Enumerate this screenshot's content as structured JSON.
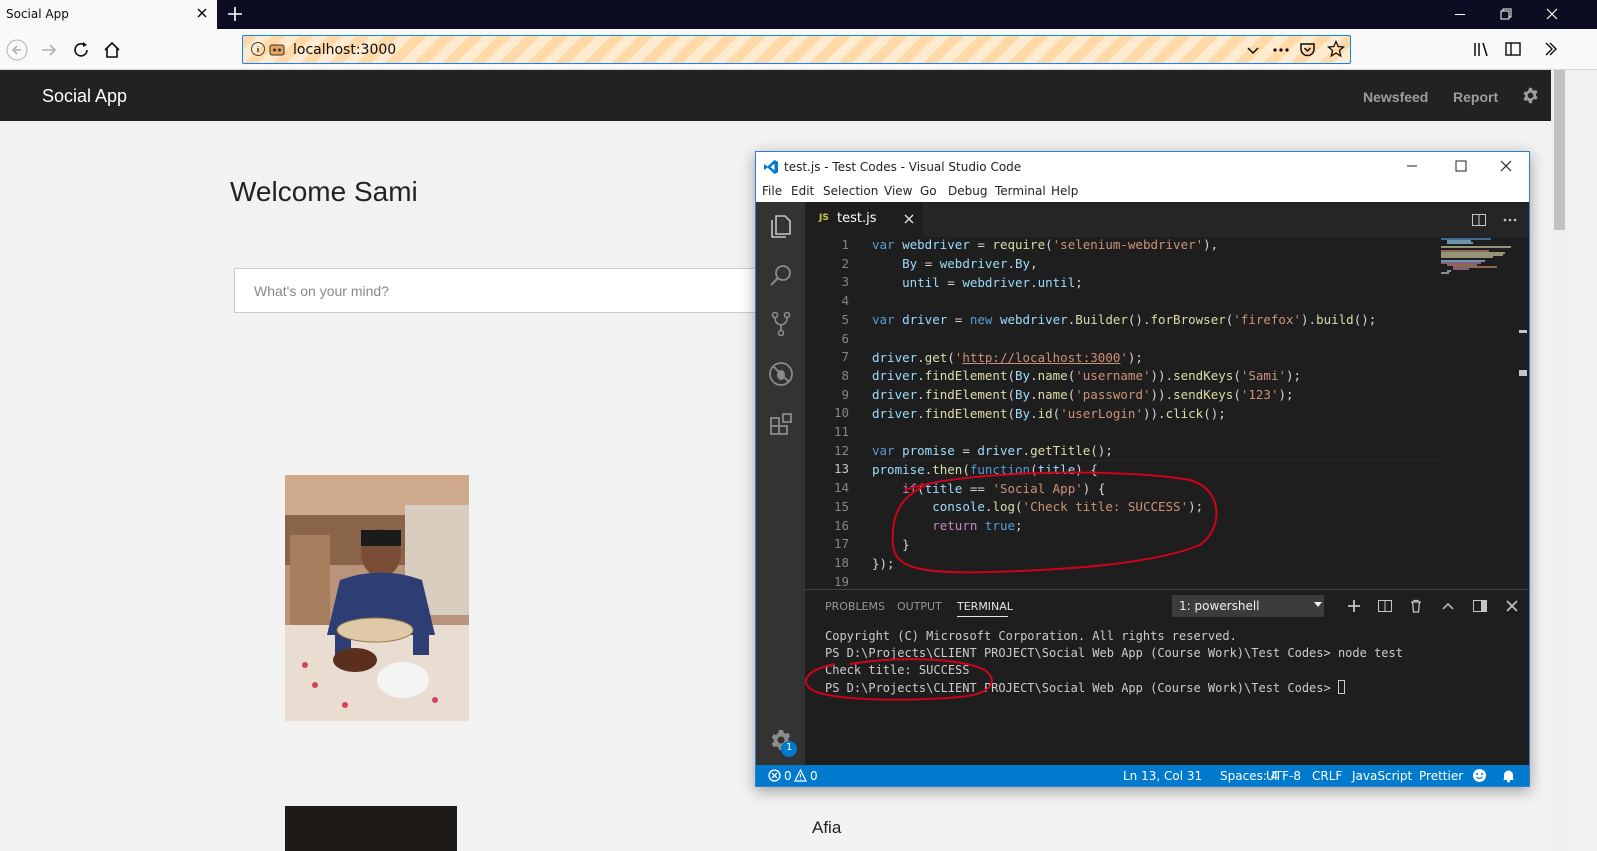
{
  "browser": {
    "tab_title": "Social App",
    "url": "localhost:3000"
  },
  "app": {
    "brand": "Social App",
    "nav": [
      "Newsfeed",
      "Report"
    ],
    "welcome": "Welcome Sami",
    "post_placeholder": "What's on your mind?",
    "next_post_author": "Afia"
  },
  "vscode": {
    "title": "test.js - Test Codes - Visual Studio Code",
    "menu": [
      "File",
      "Edit",
      "Selection",
      "View",
      "Go",
      "Debug",
      "Terminal",
      "Help"
    ],
    "tab": {
      "badge": "JS",
      "label": "test.js"
    },
    "line_numbers": [
      "1",
      "2",
      "3",
      "4",
      "5",
      "6",
      "7",
      "8",
      "9",
      "10",
      "11",
      "12",
      "13",
      "14",
      "15",
      "16",
      "17",
      "18",
      "19"
    ],
    "panel_tabs": [
      "PROBLEMS",
      "OUTPUT",
      "TERMINAL"
    ],
    "active_panel_tab": "TERMINAL",
    "terminal_select": "1: powershell",
    "terminal_lines": [
      "Copyright (C) Microsoft Corporation. All rights reserved.",
      "PS D:\\Projects\\CLIENT PROJECT\\Social Web App (Course Work)\\Test Codes> node test",
      "Check title: SUCCESS",
      "PS D:\\Projects\\CLIENT PROJECT\\Social Web App (Course Work)\\Test Codes> "
    ],
    "status": {
      "errors": "0",
      "warnings": "0",
      "position": "Ln 13, Col 31",
      "spaces": "Spaces: 4",
      "encoding": "UTF-8",
      "eol": "CRLF",
      "language": "JavaScript",
      "formatter": "Prettier"
    },
    "settings_badge": "1"
  },
  "colors": {
    "accent": "#007acc",
    "annotation": "#d0021b",
    "url_focus": "#0a84ff"
  }
}
